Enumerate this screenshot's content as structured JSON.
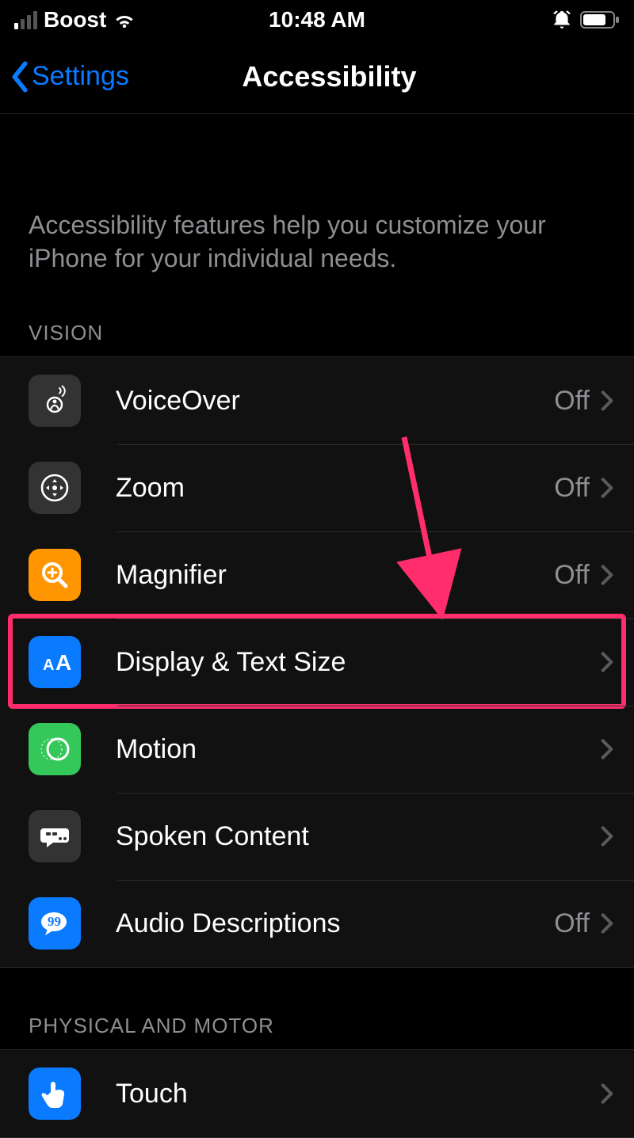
{
  "status": {
    "carrier": "Boost",
    "time": "10:48 AM"
  },
  "nav": {
    "back": "Settings",
    "title": "Accessibility"
  },
  "intro": "Accessibility features help you customize your iPhone for your individual needs.",
  "sections": {
    "vision_header": "VISION",
    "physical_header": "PHYSICAL AND MOTOR"
  },
  "rows": {
    "voiceover": {
      "label": "VoiceOver",
      "value": "Off"
    },
    "zoom": {
      "label": "Zoom",
      "value": "Off"
    },
    "magnifier": {
      "label": "Magnifier",
      "value": "Off"
    },
    "display": {
      "label": "Display & Text Size",
      "value": ""
    },
    "motion": {
      "label": "Motion",
      "value": ""
    },
    "spoken": {
      "label": "Spoken Content",
      "value": ""
    },
    "audio": {
      "label": "Audio Descriptions",
      "value": "Off"
    },
    "touch": {
      "label": "Touch",
      "value": ""
    }
  },
  "annotation": {
    "highlighted_row": "display"
  }
}
